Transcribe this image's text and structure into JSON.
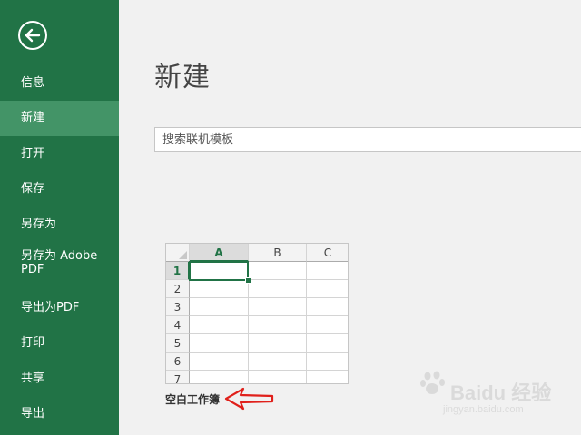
{
  "sidebar": {
    "back_label": "",
    "items": [
      {
        "label": "信息",
        "active": false
      },
      {
        "label": "新建",
        "active": true
      },
      {
        "label": "打开",
        "active": false
      },
      {
        "label": "保存",
        "active": false
      },
      {
        "label": "另存为",
        "active": false
      },
      {
        "label": "另存为 Adobe PDF",
        "active": false
      },
      {
        "label": "导出为PDF",
        "active": false
      },
      {
        "label": "打印",
        "active": false
      },
      {
        "label": "共享",
        "active": false
      },
      {
        "label": "导出",
        "active": false
      }
    ]
  },
  "main": {
    "title": "新建",
    "search": {
      "placeholder": "搜索联机模板",
      "value": ""
    },
    "template": {
      "columns": [
        "A",
        "B",
        "C"
      ],
      "rows": [
        "1",
        "2",
        "3",
        "4",
        "5",
        "6",
        "7"
      ],
      "selected_cell": "A1",
      "label": "空白工作簿"
    }
  },
  "colors": {
    "sidebar_bg": "#217346",
    "sidebar_active": "#439467",
    "accent": "#217346",
    "annotation_arrow": "#e0201b"
  },
  "watermark": {
    "brand": "Baidu 经验",
    "url": "jingyan.baidu.com"
  }
}
